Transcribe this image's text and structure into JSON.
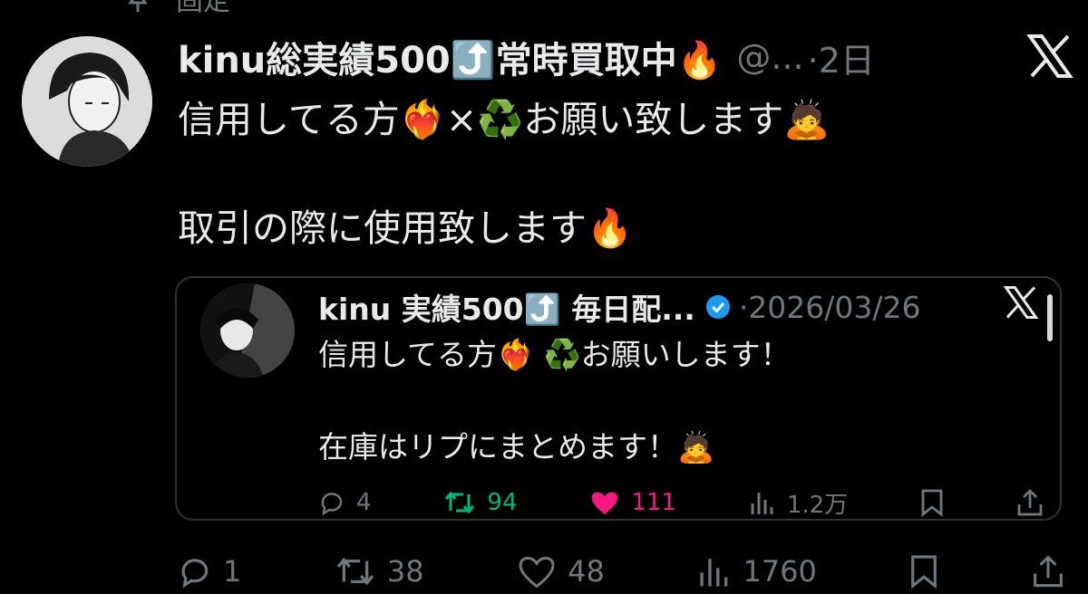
{
  "pinned": {
    "label": "固定"
  },
  "tweet": {
    "display_name": "kinu総実績500⤴️常時買取中🔥",
    "handle": "@...",
    "sep_time": "·2日",
    "lines": [
      "信用してる方❤️‍🔥×♻️お願い致します🙇",
      "取引の際に使用致します🔥"
    ]
  },
  "quote": {
    "display_name": "kinu 実績500⤴️ 毎日配...",
    "verified": true,
    "date": "·2026/03/26",
    "lines": [
      "信用してる方❤️‍🔥 ♻️お願いします！",
      "在庫はリプにまとめます！🙇"
    ],
    "stats": {
      "replies": "4",
      "retweets": "94",
      "likes": "111",
      "views": "1.2万"
    }
  },
  "stats": {
    "replies": "1",
    "retweets": "38",
    "likes": "48",
    "views": "1760"
  },
  "colors": {
    "background": "#000000",
    "text": "#e7e9ea",
    "secondary": "#71767b",
    "retweet": "#00ba7c",
    "like": "#f91880",
    "verified": "#1d9bf0"
  },
  "icons": {
    "pinned": "pin-icon",
    "platform": "x-logo-icon",
    "reply": "reply-icon",
    "retweet": "retweet-icon",
    "like": "heart-icon",
    "views": "views-icon",
    "bookmark": "bookmark-icon",
    "share": "share-icon"
  }
}
